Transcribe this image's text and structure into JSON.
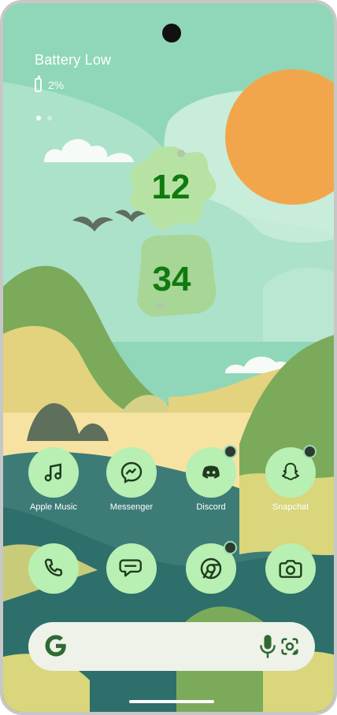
{
  "status": {
    "title": "Battery Low",
    "battery_text": "2%"
  },
  "clock": {
    "hours": "12",
    "minutes": "34"
  },
  "apps_row1": [
    {
      "label": "Apple Music",
      "icon": "music-note-icon",
      "badge": false
    },
    {
      "label": "Messenger",
      "icon": "messenger-icon",
      "badge": false
    },
    {
      "label": "Discord",
      "icon": "discord-icon",
      "badge": true
    },
    {
      "label": "Snapchat",
      "icon": "snapchat-icon",
      "badge": true
    }
  ],
  "apps_row2": [
    {
      "icon": "phone-icon",
      "badge": false
    },
    {
      "icon": "chat-icon",
      "badge": false
    },
    {
      "icon": "chrome-icon",
      "badge": true
    },
    {
      "icon": "camera-icon",
      "badge": false
    }
  ],
  "colors": {
    "icon_bg": "#b8efb2",
    "icon_fg": "#1f3b1f",
    "clock_text": "#0f7a0f",
    "search_bg": "#eef2e8"
  }
}
